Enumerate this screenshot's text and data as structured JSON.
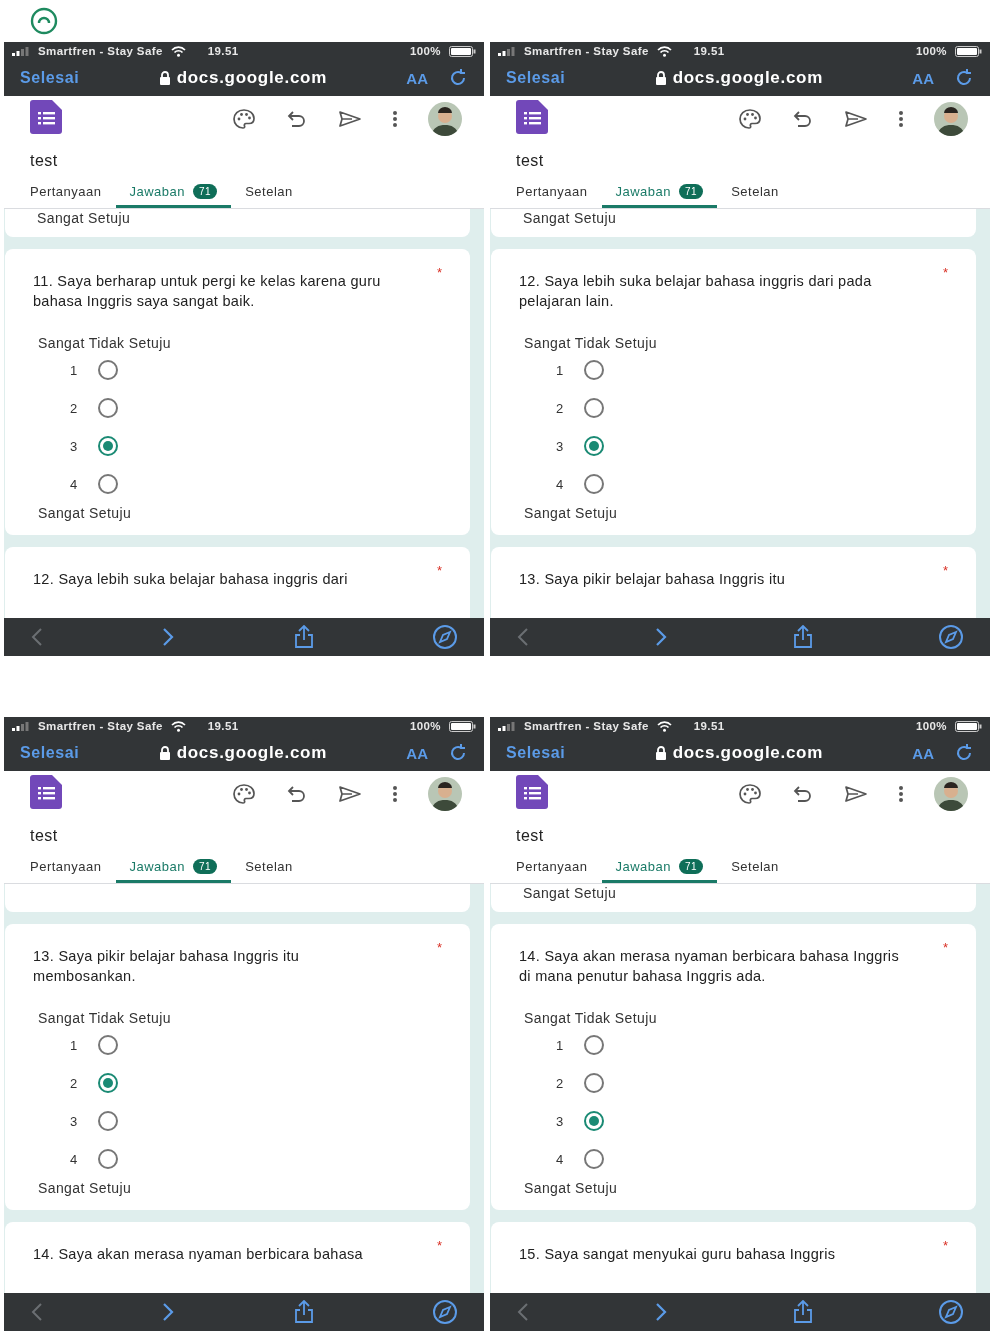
{
  "panels": [
    {
      "status": {
        "carrier": "Smartfren - Stay Safe",
        "time": "19.51",
        "battery": "100%"
      },
      "browser": {
        "done": "Selesai",
        "url": "docs.google.com",
        "text_size": "AA"
      },
      "form_title": "test",
      "tabs": [
        {
          "label": "Pertanyaan",
          "selected": false
        },
        {
          "label": "Jawaban",
          "selected": true,
          "badge": "71"
        },
        {
          "label": "Setelan",
          "selected": false
        }
      ],
      "previous_label": "Sangat Setuju",
      "question": {
        "text": "11. Saya berharap untuk pergi ke kelas karena guru bahasa Inggris saya sangat baik.",
        "required": "*",
        "low_label": "Sangat Tidak Setuju",
        "high_label": "Sangat Setuju",
        "options": [
          {
            "label": "1",
            "selected": false
          },
          {
            "label": "2",
            "selected": false
          },
          {
            "label": "3",
            "selected": true
          },
          {
            "label": "4",
            "selected": false
          }
        ]
      },
      "next_question": {
        "text": "12. Saya lebih suka belajar bahasa inggris dari",
        "required": "*"
      }
    },
    {
      "status": {
        "carrier": "Smartfren - Stay Safe",
        "time": "19.51",
        "battery": "100%"
      },
      "browser": {
        "done": "Selesai",
        "url": "docs.google.com",
        "text_size": "AA"
      },
      "form_title": "test",
      "tabs": [
        {
          "label": "Pertanyaan",
          "selected": false
        },
        {
          "label": "Jawaban",
          "selected": true,
          "badge": "71"
        },
        {
          "label": "Setelan",
          "selected": false
        }
      ],
      "previous_label": "Sangat Setuju",
      "question": {
        "text": "12. Saya lebih suka belajar bahasa inggris dari pada pelajaran lain.",
        "required": "*",
        "low_label": "Sangat Tidak Setuju",
        "high_label": "Sangat Setuju",
        "options": [
          {
            "label": "1",
            "selected": false
          },
          {
            "label": "2",
            "selected": false
          },
          {
            "label": "3",
            "selected": true
          },
          {
            "label": "4",
            "selected": false
          }
        ]
      },
      "next_question": {
        "text": "13. Saya pikir belajar bahasa Inggris itu",
        "required": "*"
      }
    },
    {
      "status": {
        "carrier": "Smartfren - Stay Safe",
        "time": "19.51",
        "battery": "100%"
      },
      "browser": {
        "done": "Selesai",
        "url": "docs.google.com",
        "text_size": "AA"
      },
      "form_title": "test",
      "tabs": [
        {
          "label": "Pertanyaan",
          "selected": false
        },
        {
          "label": "Jawaban",
          "selected": true,
          "badge": "71"
        },
        {
          "label": "Setelan",
          "selected": false
        }
      ],
      "question": {
        "text": "13. Saya pikir belajar bahasa Inggris itu membosankan.",
        "required": "*",
        "low_label": "Sangat Tidak Setuju",
        "high_label": "Sangat Setuju",
        "options": [
          {
            "label": "1",
            "selected": false
          },
          {
            "label": "2",
            "selected": true
          },
          {
            "label": "3",
            "selected": false
          },
          {
            "label": "4",
            "selected": false
          }
        ]
      },
      "next_question": {
        "text": "14. Saya akan merasa nyaman berbicara bahasa",
        "required": "*"
      }
    },
    {
      "status": {
        "carrier": "Smartfren - Stay Safe",
        "time": "19.51",
        "battery": "100%"
      },
      "browser": {
        "done": "Selesai",
        "url": "docs.google.com",
        "text_size": "AA"
      },
      "form_title": "test",
      "tabs": [
        {
          "label": "Pertanyaan",
          "selected": false
        },
        {
          "label": "Jawaban",
          "selected": true,
          "badge": "71"
        },
        {
          "label": "Setelan",
          "selected": false
        }
      ],
      "previous_label": "Sangat Setuju",
      "question": {
        "text": "14. Saya akan merasa nyaman berbicara bahasa Inggris di mana penutur bahasa Inggris ada.",
        "required": "*",
        "low_label": "Sangat Tidak Setuju",
        "high_label": "Sangat Setuju",
        "options": [
          {
            "label": "1",
            "selected": false
          },
          {
            "label": "2",
            "selected": false
          },
          {
            "label": "3",
            "selected": true
          },
          {
            "label": "4",
            "selected": false
          }
        ]
      },
      "next_question": {
        "text": "15. Saya sangat menyukai guru bahasa Inggris",
        "required": "*"
      }
    }
  ]
}
